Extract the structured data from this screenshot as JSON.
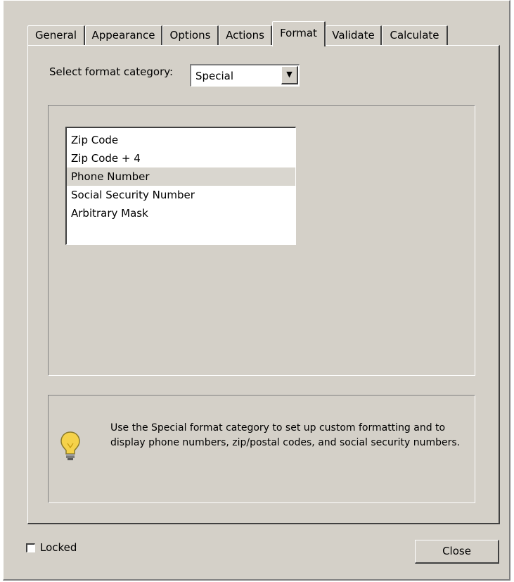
{
  "tabs": [
    {
      "label": "General",
      "active": false
    },
    {
      "label": "Appearance",
      "active": false
    },
    {
      "label": "Options",
      "active": false
    },
    {
      "label": "Actions",
      "active": false
    },
    {
      "label": "Format",
      "active": true
    },
    {
      "label": "Validate",
      "active": false
    },
    {
      "label": "Calculate",
      "active": false
    }
  ],
  "format": {
    "category_label": "Select format category:",
    "category_value": "Special"
  },
  "special_list": {
    "items": [
      "Zip Code",
      "Zip Code + 4",
      "Phone Number",
      "Social Security Number",
      "Arbitrary Mask"
    ],
    "selected": "Phone Number"
  },
  "tip": {
    "icon": "lightbulb-icon",
    "text": "Use the Special format category to set up custom formatting and to display phone numbers, zip/postal codes, and social security numbers."
  },
  "footer": {
    "locked_label": "Locked",
    "locked_checked": false,
    "close_label": "Close"
  },
  "colors": {
    "face": "#d4d0c8",
    "selection": "#d9d6cf",
    "bulb": "#f5d24a"
  }
}
